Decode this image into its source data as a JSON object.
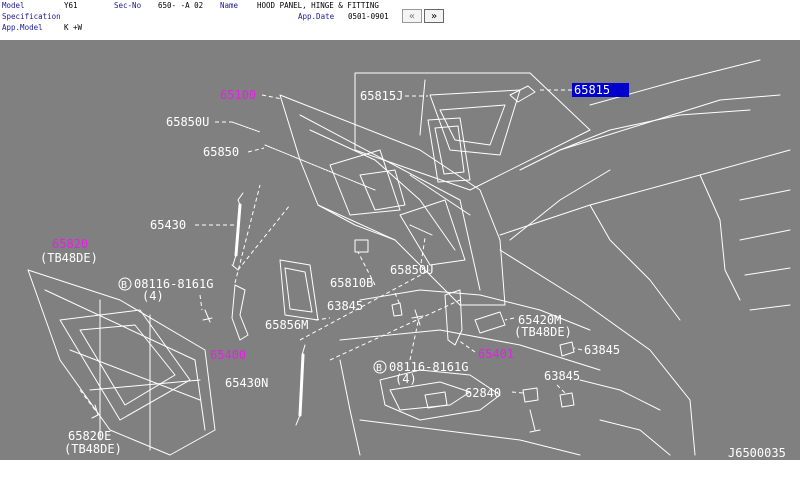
{
  "header": {
    "model_label": "Model",
    "model_value": "Y61",
    "secno_label": "Sec-No",
    "secno_value": "650-  -A 02",
    "name_label": "Name",
    "name_value": "HOOD PANEL, HINGE & FITTING",
    "spec_label": "Specification",
    "appdate_label": "App.Date",
    "appdate_value": "0501-0901",
    "appmodel_label": "App.Model",
    "appmodel_value": "K +W"
  },
  "nav": {
    "prev": "«",
    "next": "»"
  },
  "diagram": {
    "part_labels": {
      "p65100": "65100",
      "p65815J": "65815J",
      "p65815": "65815",
      "p65850U_top": "65850U",
      "p65850": "65850",
      "p65430": "65430",
      "p65820": "65820",
      "p65820_note": "(TB48DE)",
      "p08116_a": "08116-8161G",
      "p08116_a_qty": "(4)",
      "p65401_left": "65400",
      "p65810B": "65810B",
      "p65850U_mid": "65850U",
      "p63845_a": "63845",
      "p65856M": "65856M",
      "p65420M": "65420M",
      "p65420M_note": "(TB48DE)",
      "p65401": "65401",
      "p63845_b": "63845",
      "p65430N": "65430N",
      "p08116_b": "08116-8161G",
      "p08116_b_qty": "(4)",
      "p62840": "62840",
      "p63845_c": "63845",
      "p65820E": "65820E",
      "p65820E_note": "(TB48DE)"
    },
    "bolt_marker": "B",
    "drawing_id": "J6500035"
  },
  "colors": {
    "background": "#808080",
    "line": "#ffffff",
    "link": "#e81ee8",
    "highlight": "#0000cc",
    "header_label": "#1a1a9c"
  }
}
